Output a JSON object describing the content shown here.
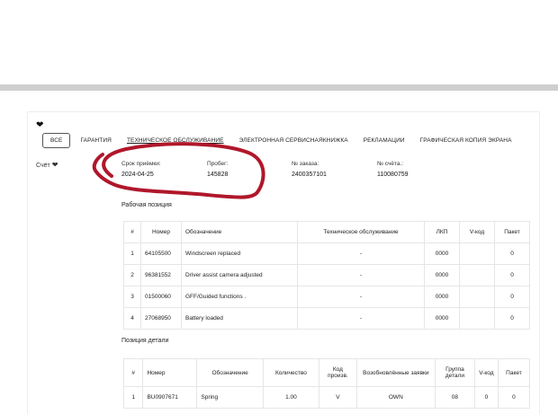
{
  "colors": {
    "accent": "#b0172b",
    "topbar": "#cfcfcf"
  },
  "icons": {
    "collapse": "chevron-down-icon"
  },
  "tabs": [
    "ВСЕ",
    "ГАРАНТИЯ",
    "ТЕХНИЧЕСКОЕ ОБСЛУЖИВАНИЕ",
    "ЭЛЕКТРОННАЯ СЕРВИСНАЯКНИЖКА",
    "РЕКЛАМАЦИИ",
    "ГРАФИЧЕСКАЯ КОПИЯ ЭКРАНА"
  ],
  "invoice": {
    "toggle_label": "Счёт",
    "fields": [
      {
        "label": "Срок приёмки:",
        "value": "2024-04-25"
      },
      {
        "label": "Пробег:",
        "value": "145828"
      },
      {
        "label": "№ заказа:",
        "value": "2400357101"
      },
      {
        "label": "№ счёта.:",
        "value": "110080759"
      }
    ]
  },
  "work_positions": {
    "title": "Рабочая позиция",
    "headers": [
      "#",
      "Номер",
      "Обозначение",
      "Техническое обслуживание",
      "ЛКП",
      "V-код",
      "Пакет"
    ],
    "rows": [
      [
        "1",
        "64105500",
        "Windscreen replaced",
        "-",
        "0000",
        "",
        "0"
      ],
      [
        "2",
        "96381552",
        "Driver assist camera adjusted",
        "-",
        "0000",
        "",
        "0"
      ],
      [
        "3",
        "01500060",
        "GFF/Guided functions .",
        "-",
        "0000",
        "",
        "0"
      ],
      [
        "4",
        "27068950",
        "Battery loaded",
        "-",
        "0000",
        "",
        "0"
      ]
    ]
  },
  "parts_positions": {
    "title": "Позиция детали",
    "headers": [
      "#",
      "Номер",
      "Обозначение",
      "Количество",
      "Код произв.",
      "Возобновлённые заявки",
      "Группа детали",
      "V-код",
      "Пакет"
    ],
    "rows": [
      [
        "1",
        "BU0907671",
        "Spring",
        "1.00",
        "V",
        "OWN",
        "08",
        "0",
        "0"
      ]
    ]
  }
}
